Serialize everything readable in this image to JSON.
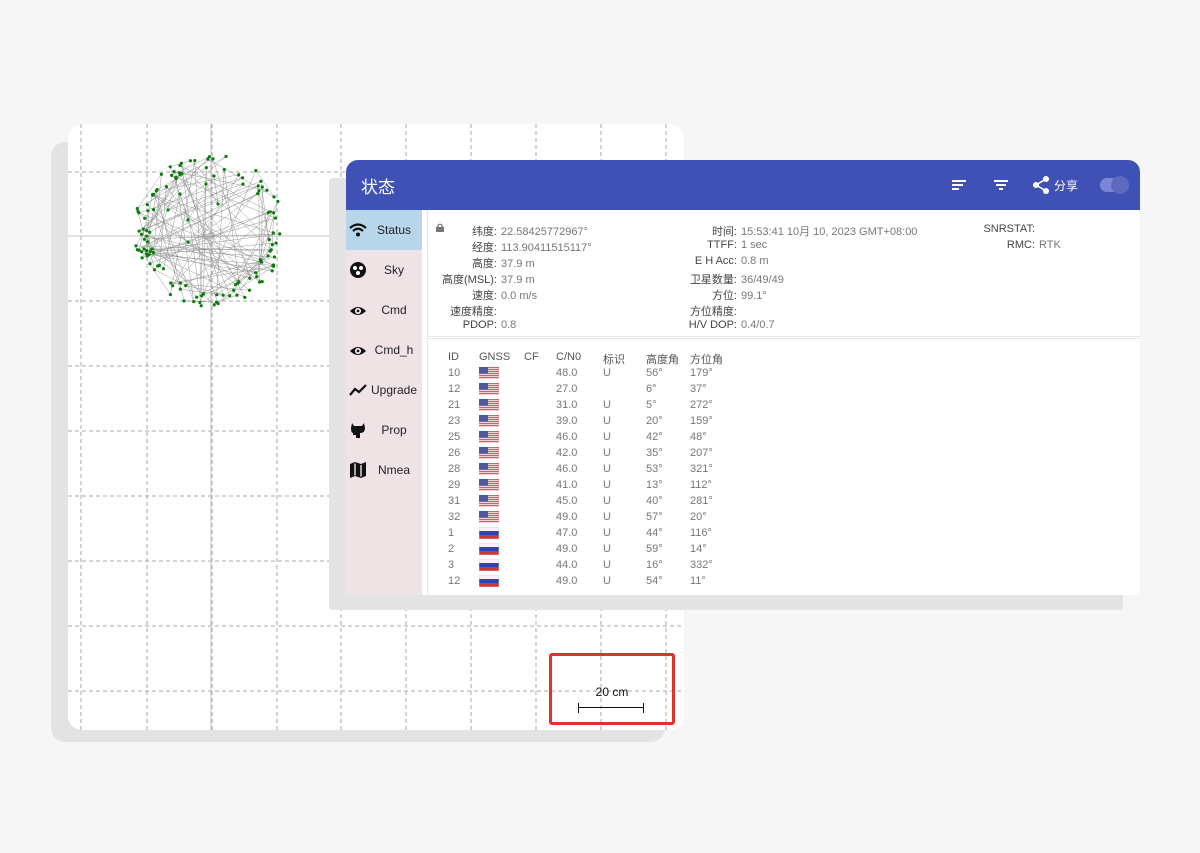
{
  "map": {
    "scale_label": "20 cm",
    "colors": {
      "points": "#0a7d0a",
      "track": "#8a8a8a",
      "grid": "#a9a9a9"
    }
  },
  "window": {
    "title": "状态",
    "actions": {
      "sort_icon": "sort-icon",
      "filter_icon": "filter-icon",
      "share_label": "分享",
      "toggle_on": true
    },
    "colors": {
      "appbar": "#3f51b5",
      "sidebar": "#efe3e5",
      "active_tab": "#b7d6ea"
    }
  },
  "sidebar": {
    "items": [
      {
        "label": "Status",
        "icon": "wifi-icon",
        "active": true
      },
      {
        "label": "Sky",
        "icon": "satellite-dish-icon",
        "active": false
      },
      {
        "label": "Cmd",
        "icon": "eye-icon",
        "active": false
      },
      {
        "label": "Cmd_h",
        "icon": "eye-icon",
        "active": false
      },
      {
        "label": "Upgrade",
        "icon": "trend-icon",
        "active": false
      },
      {
        "label": "Prop",
        "icon": "github-icon",
        "active": false
      },
      {
        "label": "Nmea",
        "icon": "map-icon",
        "active": false
      }
    ]
  },
  "status": {
    "col1": [
      {
        "k": "纬度:",
        "v": "22.58425772967°"
      },
      {
        "k": "经度:",
        "v": "113.90411515117°"
      },
      {
        "k": "高度:",
        "v": "37.9 m"
      },
      {
        "k": "高度(MSL):",
        "v": "37.9 m"
      },
      {
        "k": "速度:",
        "v": "0.0 m/s"
      },
      {
        "k": "速度精度:",
        "v": ""
      },
      {
        "k": "PDOP:",
        "v": "0.8"
      }
    ],
    "col2": [
      {
        "k": "时间:",
        "v": "15:53:41 10月 10, 2023 GMT+08:00"
      },
      {
        "k": "TTFF:",
        "v": "1 sec"
      },
      {
        "k": "E H Acc:",
        "v": "0.8 m"
      },
      {
        "k": "卫星数量:",
        "v": "36/49/49"
      },
      {
        "k": "方位:",
        "v": "99.1°"
      },
      {
        "k": "方位精度:",
        "v": ""
      },
      {
        "k": "H/V DOP:",
        "v": "0.4/0.7"
      }
    ],
    "col3": [
      {
        "k": "SNRSTAT:",
        "v": ""
      },
      {
        "k": "RMC:",
        "v": "RTK"
      }
    ]
  },
  "table": {
    "headers": [
      "ID",
      "GNSS",
      "CF",
      "C/N0",
      "标识",
      "高度角",
      "方位角"
    ],
    "rows": [
      {
        "id": "10",
        "gnss": "us",
        "cf": "",
        "cn0": "48.0",
        "flag": "U",
        "elev": "56°",
        "azim": "179°"
      },
      {
        "id": "12",
        "gnss": "us",
        "cf": "",
        "cn0": "27.0",
        "flag": "",
        "elev": "6°",
        "azim": "37°"
      },
      {
        "id": "21",
        "gnss": "us",
        "cf": "",
        "cn0": "31.0",
        "flag": "U",
        "elev": "5°",
        "azim": "272°"
      },
      {
        "id": "23",
        "gnss": "us",
        "cf": "",
        "cn0": "39.0",
        "flag": "U",
        "elev": "20°",
        "azim": "159°"
      },
      {
        "id": "25",
        "gnss": "us",
        "cf": "",
        "cn0": "46.0",
        "flag": "U",
        "elev": "42°",
        "azim": "48°"
      },
      {
        "id": "26",
        "gnss": "us",
        "cf": "",
        "cn0": "42.0",
        "flag": "U",
        "elev": "35°",
        "azim": "207°"
      },
      {
        "id": "28",
        "gnss": "us",
        "cf": "",
        "cn0": "46.0",
        "flag": "U",
        "elev": "53°",
        "azim": "321°"
      },
      {
        "id": "29",
        "gnss": "us",
        "cf": "",
        "cn0": "41.0",
        "flag": "U",
        "elev": "13°",
        "azim": "112°"
      },
      {
        "id": "31",
        "gnss": "us",
        "cf": "",
        "cn0": "45.0",
        "flag": "U",
        "elev": "40°",
        "azim": "281°"
      },
      {
        "id": "32",
        "gnss": "us",
        "cf": "",
        "cn0": "49.0",
        "flag": "U",
        "elev": "57°",
        "azim": "20°"
      },
      {
        "id": "1",
        "gnss": "ru",
        "cf": "",
        "cn0": "47.0",
        "flag": "U",
        "elev": "44°",
        "azim": "116°"
      },
      {
        "id": "2",
        "gnss": "ru",
        "cf": "",
        "cn0": "49.0",
        "flag": "U",
        "elev": "59°",
        "azim": "14°"
      },
      {
        "id": "3",
        "gnss": "ru",
        "cf": "",
        "cn0": "44.0",
        "flag": "U",
        "elev": "16°",
        "azim": "332°"
      },
      {
        "id": "12",
        "gnss": "ru",
        "cf": "",
        "cn0": "49.0",
        "flag": "U",
        "elev": "54°",
        "azim": "11°"
      }
    ]
  }
}
